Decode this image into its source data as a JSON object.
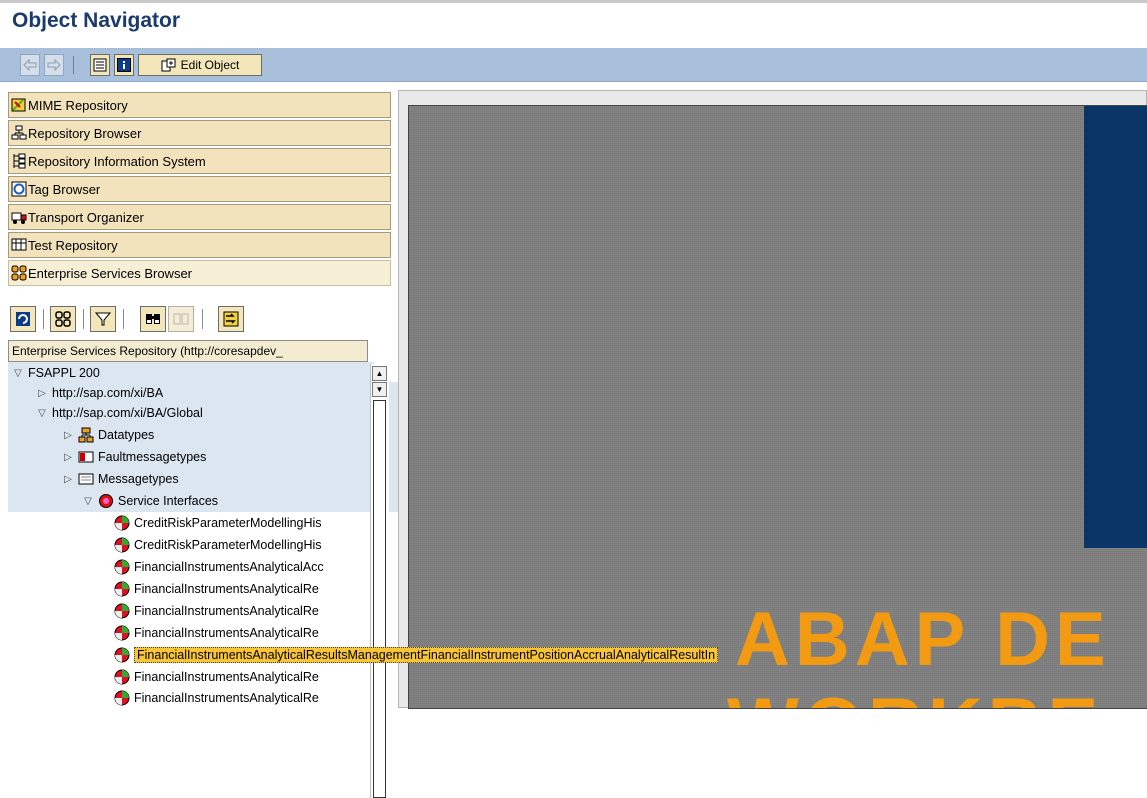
{
  "window": {
    "title": "Object Navigator"
  },
  "toolbar": {
    "back_icon": "back-arrow-icon",
    "forward_icon": "forward-arrow-icon",
    "display_object_list_icon": "object-list-icon",
    "info_icon": "info-icon",
    "edit_object_label": "Edit Object"
  },
  "navigation": {
    "items": [
      {
        "label": "MIME Repository",
        "icon": "mime-repository-icon"
      },
      {
        "label": "Repository Browser",
        "icon": "repository-browser-icon"
      },
      {
        "label": "Repository Information System",
        "icon": "repository-info-system-icon"
      },
      {
        "label": "Tag Browser",
        "icon": "tag-browser-icon"
      },
      {
        "label": "Transport Organizer",
        "icon": "transport-organizer-icon"
      },
      {
        "label": "Test Repository",
        "icon": "test-repository-icon"
      },
      {
        "label": "Enterprise Services Browser",
        "icon": "enterprise-services-icon",
        "active": true
      }
    ]
  },
  "tree_toolbar": {
    "buttons": [
      "refresh-icon",
      "services-icon",
      "filter-icon",
      "find-icon",
      "find-next-icon",
      "navigate-icon"
    ]
  },
  "tree": {
    "header": "Enterprise Services Repository (http://coresapdev_",
    "rows": [
      {
        "label": "FSAPPL 200",
        "state": "expanded",
        "level": 0,
        "icon": ""
      },
      {
        "label": "http://sap.com/xi/BA",
        "state": "collapsed",
        "level": 1,
        "icon": ""
      },
      {
        "label": "http://sap.com/xi/BA/Global",
        "state": "expanded",
        "level": 1,
        "icon": ""
      },
      {
        "label": "Datatypes",
        "state": "collapsed",
        "level": 2,
        "icon": "datatypes-icon"
      },
      {
        "label": "Faultmessagetypes",
        "state": "collapsed",
        "level": 2,
        "icon": "faultmessage-icon"
      },
      {
        "label": "Messagetypes",
        "state": "collapsed",
        "level": 2,
        "icon": "messagetype-icon"
      },
      {
        "label": "Service Interfaces",
        "state": "expanded",
        "level": 2,
        "icon": "service-interface-icon"
      },
      {
        "label": "CreditRiskParameterModellingHis",
        "level": 3,
        "icon": "service-icon"
      },
      {
        "label": "CreditRiskParameterModellingHis",
        "level": 3,
        "icon": "service-icon"
      },
      {
        "label": "FinancialInstrumentsAnalyticalAcc",
        "level": 3,
        "icon": "service-icon"
      },
      {
        "label": "FinancialInstrumentsAnalyticalRe",
        "level": 3,
        "icon": "service-icon"
      },
      {
        "label": "FinancialInstrumentsAnalyticalRe",
        "level": 3,
        "icon": "service-icon"
      },
      {
        "label": "FinancialInstrumentsAnalyticalRe",
        "level": 3,
        "icon": "service-icon"
      },
      {
        "label": "FinancialInstrumentsAnalyticalResultsManagementFinancialInstrumentPositionAccrualAnalyticalResultIn",
        "level": 3,
        "icon": "service-icon",
        "highlighted": true
      },
      {
        "label": "FinancialInstrumentsAnalyticalRe",
        "level": 3,
        "icon": "service-icon"
      },
      {
        "label": "FinancialInstrumentsAnalyticalRe",
        "level": 3,
        "icon": "service-icon"
      }
    ]
  },
  "splash": {
    "line1": "ABAP DE",
    "line2": "WORKBE",
    "accent_color": "#f29a12",
    "block_color": "#0a3566"
  }
}
